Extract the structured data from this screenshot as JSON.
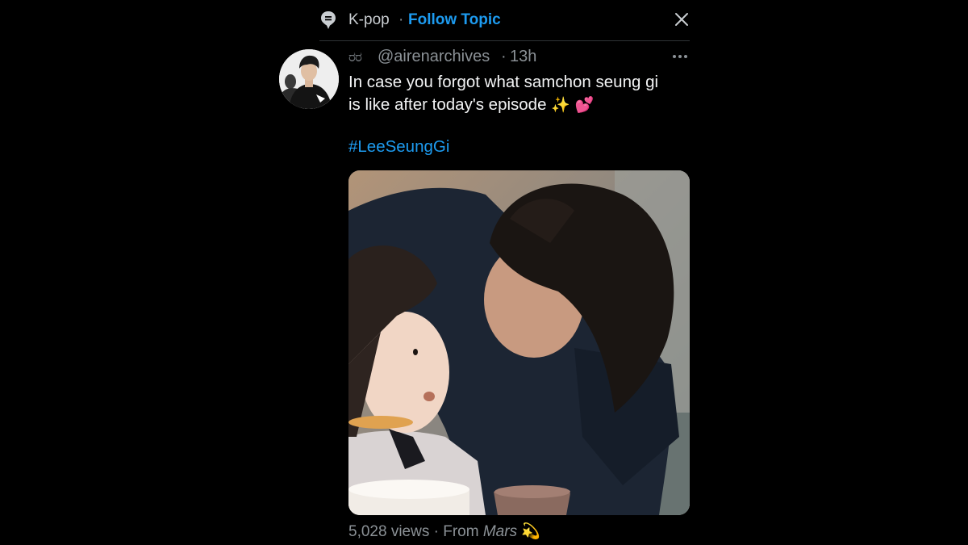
{
  "topic": {
    "icon": "topic-pin-icon",
    "name": "K-pop",
    "separator": "·",
    "follow_label": "Follow Topic",
    "close_icon": "close-icon"
  },
  "tweet": {
    "avatar": "avatar",
    "badge_icon": "eyes-icon",
    "badge_glyph": "ರರ",
    "handle": "@airenarchives",
    "separator": "·",
    "time": "13h",
    "more_icon": "more-icon",
    "text_line1": "In case you forgot what samchon seung gi",
    "text_line2": "is like after today's episode",
    "emoji_1": "✨",
    "emoji_2": "💕",
    "hashtag": "#LeeSeungGi",
    "media": "video-thumbnail",
    "views": "5,028 views",
    "stats_separator": "·",
    "from_label": "From",
    "from_name": "Mars",
    "from_emoji": "💫"
  },
  "colors": {
    "background": "#000000",
    "accent": "#1d9bf0",
    "text_primary": "#f3f4f5",
    "text_secondary": "#8b9196"
  }
}
